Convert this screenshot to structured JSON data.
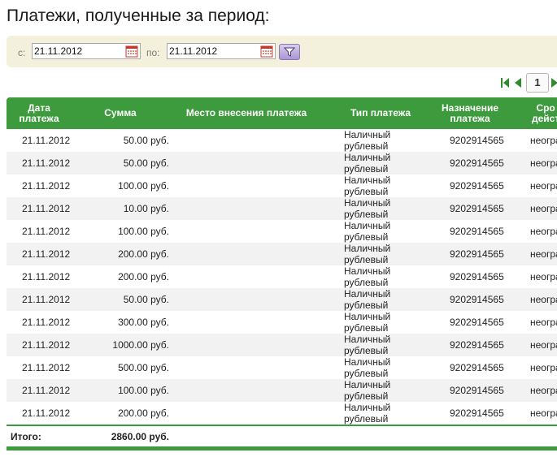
{
  "page": {
    "title": "Платежи, полученные за период:"
  },
  "filter": {
    "from_label": "с:",
    "from_value": "21.11.2012",
    "to_label": "по:",
    "to_value": "21.11.2012"
  },
  "pagination": {
    "current_page": "1"
  },
  "table": {
    "headers": {
      "date": [
        "Дата",
        "платежа"
      ],
      "sum": "Сумма",
      "place": "Место внесения платежа",
      "type": "Тип платежа",
      "purpose": [
        "Назначение",
        "платежа"
      ],
      "term": [
        "Сро",
        "дейст"
      ]
    },
    "rows": [
      {
        "date": "21.11.2012",
        "sum": "50.00 руб.",
        "place": "",
        "type": [
          "Наличный",
          "рублевый"
        ],
        "purpose": "9202914565",
        "term": "неогра"
      },
      {
        "date": "21.11.2012",
        "sum": "50.00 руб.",
        "place": "",
        "type": [
          "Наличный",
          "рублевый"
        ],
        "purpose": "9202914565",
        "term": "неогра"
      },
      {
        "date": "21.11.2012",
        "sum": "100.00 руб.",
        "place": "",
        "type": [
          "Наличный",
          "рублевый"
        ],
        "purpose": "9202914565",
        "term": "неогра"
      },
      {
        "date": "21.11.2012",
        "sum": "10.00 руб.",
        "place": "",
        "type": [
          "Наличный",
          "рублевый"
        ],
        "purpose": "9202914565",
        "term": "неогра"
      },
      {
        "date": "21.11.2012",
        "sum": "100.00 руб.",
        "place": "",
        "type": [
          "Наличный",
          "рублевый"
        ],
        "purpose": "9202914565",
        "term": "неогра"
      },
      {
        "date": "21.11.2012",
        "sum": "200.00 руб.",
        "place": "",
        "type": [
          "Наличный",
          "рублевый"
        ],
        "purpose": "9202914565",
        "term": "неогра"
      },
      {
        "date": "21.11.2012",
        "sum": "200.00 руб.",
        "place": "",
        "type": [
          "Наличный",
          "рублевый"
        ],
        "purpose": "9202914565",
        "term": "неогра"
      },
      {
        "date": "21.11.2012",
        "sum": "50.00 руб.",
        "place": "",
        "type": [
          "Наличный",
          "рублевый"
        ],
        "purpose": "9202914565",
        "term": "неогра"
      },
      {
        "date": "21.11.2012",
        "sum": "300.00 руб.",
        "place": "",
        "type": [
          "Наличный",
          "рублевый"
        ],
        "purpose": "9202914565",
        "term": "неогра"
      },
      {
        "date": "21.11.2012",
        "sum": "1000.00 руб.",
        "place": "",
        "type": [
          "Наличный",
          "рублевый"
        ],
        "purpose": "9202914565",
        "term": "неогра"
      },
      {
        "date": "21.11.2012",
        "sum": "500.00 руб.",
        "place": "",
        "type": [
          "Наличный",
          "рублевый"
        ],
        "purpose": "9202914565",
        "term": "неогра"
      },
      {
        "date": "21.11.2012",
        "sum": "100.00 руб.",
        "place": "",
        "type": [
          "Наличный",
          "рублевый"
        ],
        "purpose": "9202914565",
        "term": "неогра"
      },
      {
        "date": "21.11.2012",
        "sum": "200.00 руб.",
        "place": "",
        "type": [
          "Наличный",
          "рублевый"
        ],
        "purpose": "9202914565",
        "term": "неогра"
      }
    ],
    "total": {
      "label": "Итого:",
      "value": "2860.00 руб."
    }
  },
  "colors": {
    "header_green": "#3d9a3d",
    "filter_background": "#f3f0dc",
    "filter_button": "#a996d2",
    "pager_arrow": "#2e8b2e",
    "calendar_red": "#c0392b"
  },
  "icons": {
    "calendar": "calendar-icon",
    "filter": "funnel-icon",
    "first_page": "first-page-icon",
    "prev_page": "prev-page-icon",
    "next_page": "next-page-icon"
  }
}
